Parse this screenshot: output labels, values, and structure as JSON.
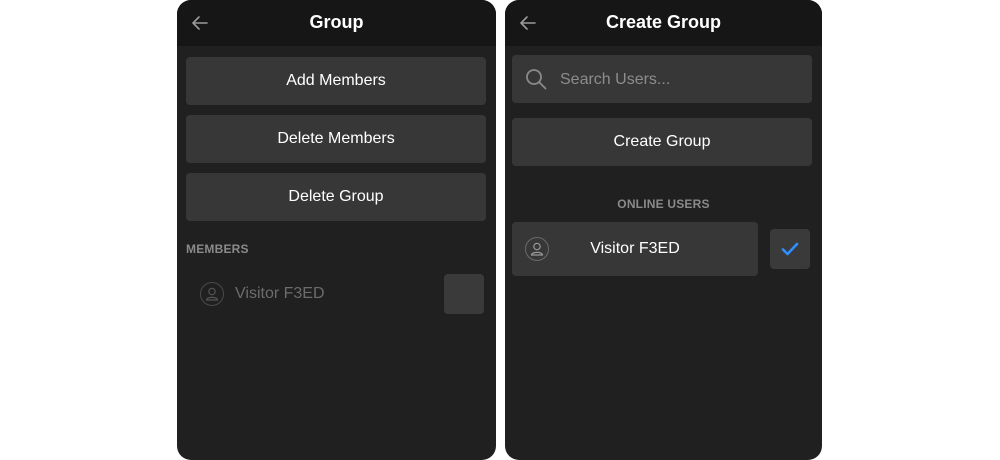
{
  "group_panel": {
    "title": "Group",
    "back_icon": "arrow-left-icon",
    "buttons": {
      "add_members": "Add Members",
      "delete_members": "Delete Members",
      "delete_group": "Delete Group"
    },
    "members_label": "MEMBERS",
    "members": [
      {
        "name": "Visitor F3ED",
        "avatar_icon": "user-icon",
        "checked": false
      }
    ]
  },
  "create_panel": {
    "title": "Create Group",
    "back_icon": "arrow-left-icon",
    "search": {
      "placeholder": "Search Users...",
      "value": "",
      "icon": "search-icon"
    },
    "create_button": "Create Group",
    "online_label": "ONLINE USERS",
    "users": [
      {
        "name": "Visitor F3ED",
        "avatar_icon": "user-icon",
        "checked": true
      }
    ]
  },
  "colors": {
    "panel_bg": "#202020",
    "header_bg": "#161616",
    "button_bg": "#373737",
    "check_accent": "#2f8fff",
    "muted_text": "#8a8a8a"
  }
}
